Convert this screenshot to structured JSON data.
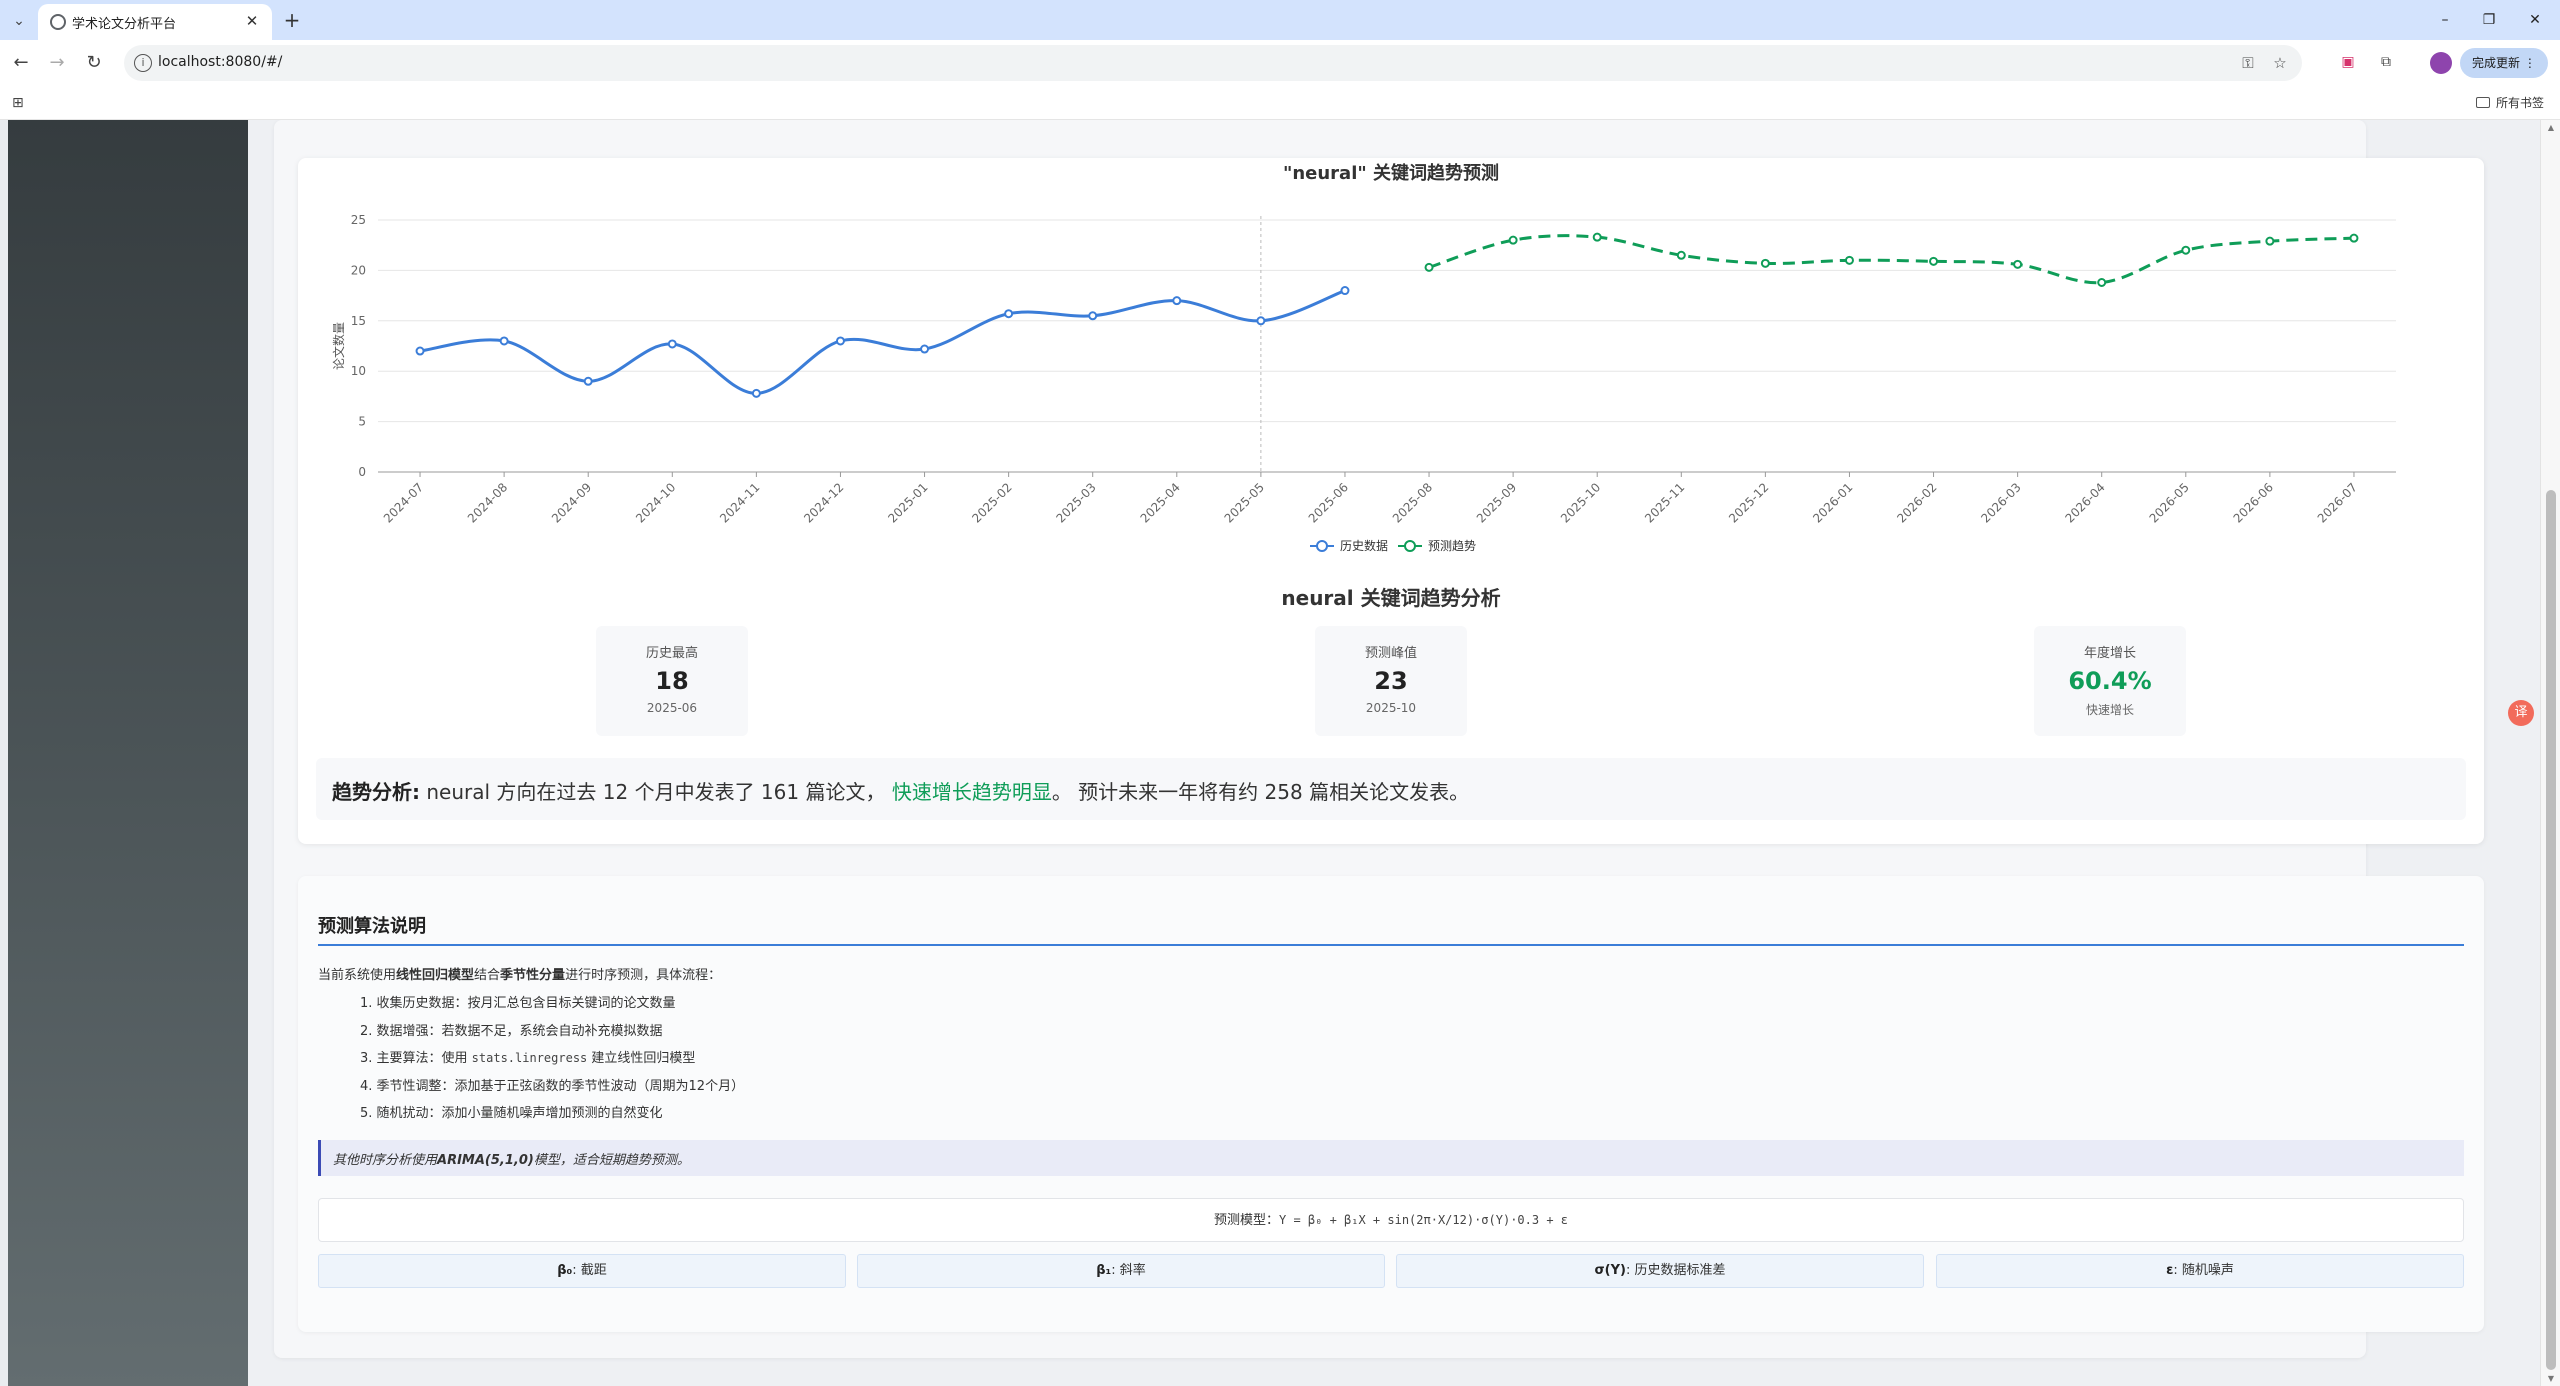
{
  "browser": {
    "tab_title": "学术论文分析平台",
    "url": "localhost:8080/#/",
    "update_label": "完成更新",
    "bookmarks_label": "所有书签"
  },
  "chart": {
    "title": "\"neural\" 关键词趋势预测",
    "ylabel": "论文数量",
    "legend_history": "历史数据",
    "legend_forecast": "预测趋势"
  },
  "chart_data": {
    "type": "line",
    "title": "\"neural\" 关键词趋势预测",
    "xlabel": "",
    "ylabel": "论文数量",
    "ylim": [
      0,
      25
    ],
    "yticks": [
      0,
      5,
      10,
      15,
      20,
      25
    ],
    "categories": [
      "2024-07",
      "2024-08",
      "2024-09",
      "2024-10",
      "2024-11",
      "2024-12",
      "2025-01",
      "2025-02",
      "2025-03",
      "2025-04",
      "2025-05",
      "2025-06",
      "2025-08",
      "2025-09",
      "2025-10",
      "2025-11",
      "2025-12",
      "2026-01",
      "2026-02",
      "2026-03",
      "2026-04",
      "2026-05",
      "2026-06",
      "2026-07"
    ],
    "grid": true,
    "legend_position": "bottom",
    "series": [
      {
        "name": "历史数据",
        "color": "#3b7dd8",
        "style": "solid",
        "start": 0,
        "values": [
          12,
          13,
          9,
          12.7,
          7.8,
          13,
          12.2,
          15.7,
          15.5,
          17,
          15,
          18
        ]
      },
      {
        "name": "预测趋势",
        "color": "#0f9d58",
        "style": "dashed",
        "start": 12,
        "values": [
          20.3,
          23,
          23.3,
          21.5,
          20.7,
          21,
          20.9,
          20.6,
          18.8,
          22,
          22.9,
          23.2
        ]
      }
    ]
  },
  "analysis": {
    "title": "neural 关键词趋势分析",
    "stats": [
      {
        "label": "历史最高",
        "value": "18",
        "sub": "2025-06",
        "color": "#222222"
      },
      {
        "label": "预测峰值",
        "value": "23",
        "sub": "2025-10",
        "color": "#222222"
      },
      {
        "label": "年度增长",
        "value": "60.4%",
        "sub": "快速增长",
        "color": "#0f9d58"
      }
    ],
    "trend_label": "趋势分析:",
    "trend_text1": "neural 方向在过去 12 个月中发表了 161 篇论文，",
    "trend_highlight": "快速增长趋势明显",
    "trend_text2": "。 预计未来一年将有约 258 篇相关论文发表。"
  },
  "algorithm": {
    "title": "预测算法说明",
    "intro_prefix": "当前系统使用",
    "intro_model": "线性回归模型",
    "intro_mid": "结合",
    "intro_season": "季节性分量",
    "intro_suffix": "进行时序预测，具体流程：",
    "steps": [
      {
        "prefix": "1. 收集历史数据：按月汇总包含目标关键词的论文数量",
        "code": "",
        "suffix": ""
      },
      {
        "prefix": "2. 数据增强：若数据不足，系统会自动补充模拟数据",
        "code": "",
        "suffix": ""
      },
      {
        "prefix": "3. 主要算法：使用 ",
        "code": "stats.linregress",
        "suffix": " 建立线性回归模型"
      },
      {
        "prefix": "4. 季节性调整：添加基于正弦函数的季节性波动（周期为12个月）",
        "code": "",
        "suffix": ""
      },
      {
        "prefix": "5. 随机扰动：添加小量随机噪声增加预测的自然变化",
        "code": "",
        "suffix": ""
      }
    ],
    "note_prefix": "其他时序分析使用",
    "note_model": "ARIMA(5,1,0)",
    "note_suffix": "模型，适合短期趋势预测。",
    "formula_label": "预测模型：",
    "formula": "Y = β₀ + β₁X + sin(2π·X/12)·σ(Y)·0.3 + ε",
    "params": [
      {
        "symbol": "β₀",
        "desc": ": 截距"
      },
      {
        "symbol": "β₁",
        "desc": ": 斜率"
      },
      {
        "symbol": "σ(Y)",
        "desc": ": 历史数据标准差"
      },
      {
        "symbol": "ε",
        "desc": ": 随机噪声"
      }
    ]
  }
}
